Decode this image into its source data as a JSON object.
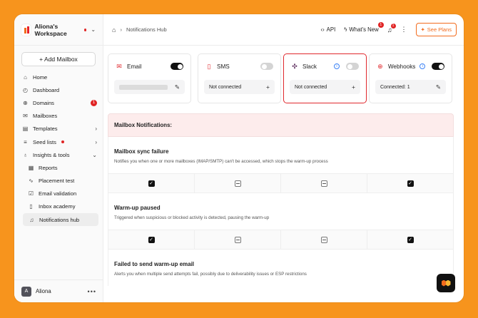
{
  "workspace": {
    "name": "Aliona's Workspace"
  },
  "sidebar": {
    "add_mailbox": "+ Add Mailbox",
    "items": [
      {
        "label": "Home",
        "icon": "home-icon"
      },
      {
        "label": "Dashboard",
        "icon": "gauge-icon"
      },
      {
        "label": "Domains",
        "icon": "globe-icon",
        "badge": "1"
      },
      {
        "label": "Mailboxes",
        "icon": "mail-icon"
      },
      {
        "label": "Templates",
        "icon": "document-icon"
      },
      {
        "label": "Seed lists",
        "icon": "list-icon"
      },
      {
        "label": "Insights & tools",
        "icon": "bulb-icon"
      }
    ],
    "sub_items": [
      {
        "label": "Reports",
        "icon": "report-icon"
      },
      {
        "label": "Placement test",
        "icon": "pulse-icon"
      },
      {
        "label": "Email validation",
        "icon": "check-mail-icon"
      },
      {
        "label": "Inbox academy",
        "icon": "book-icon"
      },
      {
        "label": "Notifications hub",
        "icon": "bell-icon"
      }
    ],
    "user": {
      "initial": "A",
      "name": "Aliona",
      "more": "•••"
    }
  },
  "topbar": {
    "breadcrumb": "Notifications Hub",
    "api": "API",
    "whats_new": "What's New",
    "whats_new_count": "1",
    "bell_count": "1",
    "see_plans": "See Plans"
  },
  "channels": [
    {
      "name": "Email",
      "enabled": true,
      "field": "",
      "action": "edit"
    },
    {
      "name": "SMS",
      "enabled": false,
      "field": "Not connected",
      "action": "add"
    },
    {
      "name": "Slack",
      "enabled": false,
      "field": "Not connected",
      "action": "add",
      "selected": true,
      "info": "i"
    },
    {
      "name": "Webhooks",
      "enabled": true,
      "field": "Connected: 1",
      "action": "edit",
      "info": "i"
    }
  ],
  "colors": {
    "accent": "#f26b1d",
    "frame_bg": "#f7941d",
    "alert": "#e02424",
    "section_bg": "#fdecec"
  },
  "table": {
    "header": "Mailbox Notifications:",
    "sections": [
      {
        "title": "Mailbox sync failure",
        "desc": "Notifies you when one or more mailboxes (IMAP/SMTP) can't be accessed, which stops the warm-up process",
        "states": [
          "checked",
          "dash",
          "dash",
          "checked"
        ]
      },
      {
        "title": "Warm-up paused",
        "desc": "Triggered when suspicious or blocked activity is detected, pausing the warm-up",
        "states": [
          "checked",
          "dash",
          "dash",
          "checked"
        ]
      },
      {
        "title": "Failed to send warm-up email",
        "desc": "Alerts you when multiple send attempts fail, possibly due to deliverability issues or ESP restrictions"
      }
    ]
  }
}
